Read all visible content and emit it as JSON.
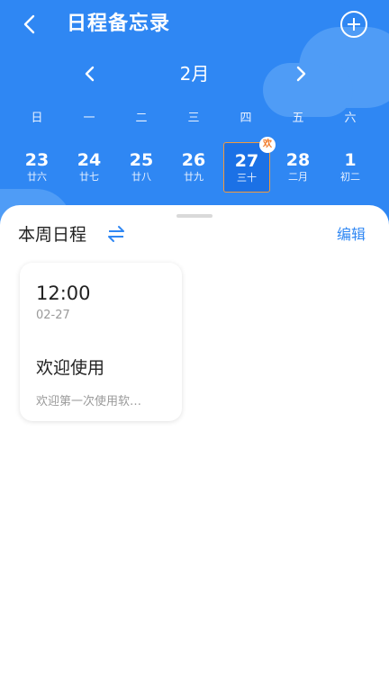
{
  "app": {
    "title": "日程备忘录"
  },
  "icons": {
    "back": "chevron-left-icon",
    "add": "plus-circle-icon",
    "prev": "chevron-left-icon",
    "next": "chevron-right-icon",
    "swap": "swap-arrows-icon"
  },
  "calendar": {
    "month": "2月",
    "weekdays": [
      "日",
      "一",
      "二",
      "三",
      "四",
      "五",
      "六"
    ],
    "days": [
      {
        "num": "23",
        "lunar": "廿六"
      },
      {
        "num": "24",
        "lunar": "廿七"
      },
      {
        "num": "25",
        "lunar": "廿八"
      },
      {
        "num": "26",
        "lunar": "廿九"
      },
      {
        "num": "27",
        "lunar": "三十",
        "selected": true,
        "badge": "欢"
      },
      {
        "num": "28",
        "lunar": "二月"
      },
      {
        "num": "1",
        "lunar": "初二"
      }
    ]
  },
  "schedule": {
    "title": "本周日程",
    "edit_label": "编辑",
    "cards": [
      {
        "time": "12:00",
        "date": "02-27",
        "title": "欢迎使用",
        "desc": "欢迎第一次使用软…"
      }
    ]
  },
  "colors": {
    "primary": "#2f87f3",
    "selected_border": "#f39a3b",
    "badge_text": "#f07a2a"
  }
}
